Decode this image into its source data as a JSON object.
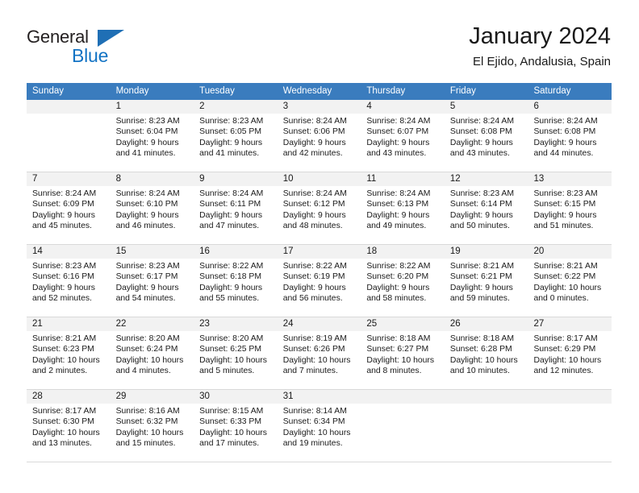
{
  "logo": {
    "word1": "General",
    "word2": "Blue",
    "triangle_color": "#1f6fb5",
    "word2_color": "#1273c4"
  },
  "header": {
    "month_title": "January 2024",
    "location": "El Ejido, Andalusia, Spain"
  },
  "calendar": {
    "header_bg": "#3a7cbe",
    "daynum_bg": "#f2f2f2",
    "weekdays": [
      "Sunday",
      "Monday",
      "Tuesday",
      "Wednesday",
      "Thursday",
      "Friday",
      "Saturday"
    ],
    "weeks": [
      [
        {
          "day": "",
          "sunrise": "",
          "sunset": "",
          "daylight1": "",
          "daylight2": "",
          "empty": true
        },
        {
          "day": "1",
          "sunrise": "Sunrise: 8:23 AM",
          "sunset": "Sunset: 6:04 PM",
          "daylight1": "Daylight: 9 hours",
          "daylight2": "and 41 minutes."
        },
        {
          "day": "2",
          "sunrise": "Sunrise: 8:23 AM",
          "sunset": "Sunset: 6:05 PM",
          "daylight1": "Daylight: 9 hours",
          "daylight2": "and 41 minutes."
        },
        {
          "day": "3",
          "sunrise": "Sunrise: 8:24 AM",
          "sunset": "Sunset: 6:06 PM",
          "daylight1": "Daylight: 9 hours",
          "daylight2": "and 42 minutes."
        },
        {
          "day": "4",
          "sunrise": "Sunrise: 8:24 AM",
          "sunset": "Sunset: 6:07 PM",
          "daylight1": "Daylight: 9 hours",
          "daylight2": "and 43 minutes."
        },
        {
          "day": "5",
          "sunrise": "Sunrise: 8:24 AM",
          "sunset": "Sunset: 6:08 PM",
          "daylight1": "Daylight: 9 hours",
          "daylight2": "and 43 minutes."
        },
        {
          "day": "6",
          "sunrise": "Sunrise: 8:24 AM",
          "sunset": "Sunset: 6:08 PM",
          "daylight1": "Daylight: 9 hours",
          "daylight2": "and 44 minutes."
        }
      ],
      [
        {
          "day": "7",
          "sunrise": "Sunrise: 8:24 AM",
          "sunset": "Sunset: 6:09 PM",
          "daylight1": "Daylight: 9 hours",
          "daylight2": "and 45 minutes."
        },
        {
          "day": "8",
          "sunrise": "Sunrise: 8:24 AM",
          "sunset": "Sunset: 6:10 PM",
          "daylight1": "Daylight: 9 hours",
          "daylight2": "and 46 minutes."
        },
        {
          "day": "9",
          "sunrise": "Sunrise: 8:24 AM",
          "sunset": "Sunset: 6:11 PM",
          "daylight1": "Daylight: 9 hours",
          "daylight2": "and 47 minutes."
        },
        {
          "day": "10",
          "sunrise": "Sunrise: 8:24 AM",
          "sunset": "Sunset: 6:12 PM",
          "daylight1": "Daylight: 9 hours",
          "daylight2": "and 48 minutes."
        },
        {
          "day": "11",
          "sunrise": "Sunrise: 8:24 AM",
          "sunset": "Sunset: 6:13 PM",
          "daylight1": "Daylight: 9 hours",
          "daylight2": "and 49 minutes."
        },
        {
          "day": "12",
          "sunrise": "Sunrise: 8:23 AM",
          "sunset": "Sunset: 6:14 PM",
          "daylight1": "Daylight: 9 hours",
          "daylight2": "and 50 minutes."
        },
        {
          "day": "13",
          "sunrise": "Sunrise: 8:23 AM",
          "sunset": "Sunset: 6:15 PM",
          "daylight1": "Daylight: 9 hours",
          "daylight2": "and 51 minutes."
        }
      ],
      [
        {
          "day": "14",
          "sunrise": "Sunrise: 8:23 AM",
          "sunset": "Sunset: 6:16 PM",
          "daylight1": "Daylight: 9 hours",
          "daylight2": "and 52 minutes."
        },
        {
          "day": "15",
          "sunrise": "Sunrise: 8:23 AM",
          "sunset": "Sunset: 6:17 PM",
          "daylight1": "Daylight: 9 hours",
          "daylight2": "and 54 minutes."
        },
        {
          "day": "16",
          "sunrise": "Sunrise: 8:22 AM",
          "sunset": "Sunset: 6:18 PM",
          "daylight1": "Daylight: 9 hours",
          "daylight2": "and 55 minutes."
        },
        {
          "day": "17",
          "sunrise": "Sunrise: 8:22 AM",
          "sunset": "Sunset: 6:19 PM",
          "daylight1": "Daylight: 9 hours",
          "daylight2": "and 56 minutes."
        },
        {
          "day": "18",
          "sunrise": "Sunrise: 8:22 AM",
          "sunset": "Sunset: 6:20 PM",
          "daylight1": "Daylight: 9 hours",
          "daylight2": "and 58 minutes."
        },
        {
          "day": "19",
          "sunrise": "Sunrise: 8:21 AM",
          "sunset": "Sunset: 6:21 PM",
          "daylight1": "Daylight: 9 hours",
          "daylight2": "and 59 minutes."
        },
        {
          "day": "20",
          "sunrise": "Sunrise: 8:21 AM",
          "sunset": "Sunset: 6:22 PM",
          "daylight1": "Daylight: 10 hours",
          "daylight2": "and 0 minutes."
        }
      ],
      [
        {
          "day": "21",
          "sunrise": "Sunrise: 8:21 AM",
          "sunset": "Sunset: 6:23 PM",
          "daylight1": "Daylight: 10 hours",
          "daylight2": "and 2 minutes."
        },
        {
          "day": "22",
          "sunrise": "Sunrise: 8:20 AM",
          "sunset": "Sunset: 6:24 PM",
          "daylight1": "Daylight: 10 hours",
          "daylight2": "and 4 minutes."
        },
        {
          "day": "23",
          "sunrise": "Sunrise: 8:20 AM",
          "sunset": "Sunset: 6:25 PM",
          "daylight1": "Daylight: 10 hours",
          "daylight2": "and 5 minutes."
        },
        {
          "day": "24",
          "sunrise": "Sunrise: 8:19 AM",
          "sunset": "Sunset: 6:26 PM",
          "daylight1": "Daylight: 10 hours",
          "daylight2": "and 7 minutes."
        },
        {
          "day": "25",
          "sunrise": "Sunrise: 8:18 AM",
          "sunset": "Sunset: 6:27 PM",
          "daylight1": "Daylight: 10 hours",
          "daylight2": "and 8 minutes."
        },
        {
          "day": "26",
          "sunrise": "Sunrise: 8:18 AM",
          "sunset": "Sunset: 6:28 PM",
          "daylight1": "Daylight: 10 hours",
          "daylight2": "and 10 minutes."
        },
        {
          "day": "27",
          "sunrise": "Sunrise: 8:17 AM",
          "sunset": "Sunset: 6:29 PM",
          "daylight1": "Daylight: 10 hours",
          "daylight2": "and 12 minutes."
        }
      ],
      [
        {
          "day": "28",
          "sunrise": "Sunrise: 8:17 AM",
          "sunset": "Sunset: 6:30 PM",
          "daylight1": "Daylight: 10 hours",
          "daylight2": "and 13 minutes."
        },
        {
          "day": "29",
          "sunrise": "Sunrise: 8:16 AM",
          "sunset": "Sunset: 6:32 PM",
          "daylight1": "Daylight: 10 hours",
          "daylight2": "and 15 minutes."
        },
        {
          "day": "30",
          "sunrise": "Sunrise: 8:15 AM",
          "sunset": "Sunset: 6:33 PM",
          "daylight1": "Daylight: 10 hours",
          "daylight2": "and 17 minutes."
        },
        {
          "day": "31",
          "sunrise": "Sunrise: 8:14 AM",
          "sunset": "Sunset: 6:34 PM",
          "daylight1": "Daylight: 10 hours",
          "daylight2": "and 19 minutes."
        },
        {
          "day": "",
          "sunrise": "",
          "sunset": "",
          "daylight1": "",
          "daylight2": "",
          "empty": true
        },
        {
          "day": "",
          "sunrise": "",
          "sunset": "",
          "daylight1": "",
          "daylight2": "",
          "empty": true
        },
        {
          "day": "",
          "sunrise": "",
          "sunset": "",
          "daylight1": "",
          "daylight2": "",
          "empty": true
        }
      ]
    ]
  }
}
